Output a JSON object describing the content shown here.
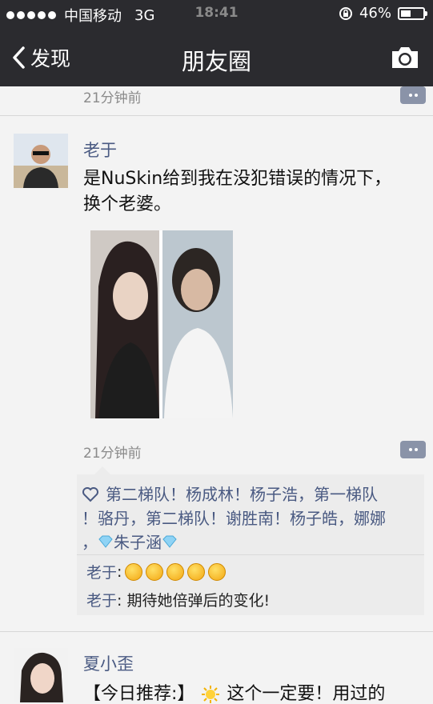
{
  "status_bar": {
    "carrier": "中国移动",
    "network": "3G",
    "time": "18:41",
    "battery": "46%",
    "battery_level": 0.46
  },
  "nav": {
    "back_label": "发现",
    "title": "朋友圈"
  },
  "feed": {
    "previous_post_time": "21分钟前",
    "posts": [
      {
        "author": "老于",
        "text_line1": "是NuSkin给到我在没犯错误的情况下，",
        "text_line2": "换个老婆。",
        "time": "21分钟前",
        "likes": {
          "line1": "第二梯队！杨成林！杨子浩，第一梯队",
          "line2": "！骆丹，第二梯队！谢胜南！杨子皓，娜娜",
          "line3_prefix": "，",
          "line3_name": "朱子涵"
        },
        "comments": [
          {
            "author": "老于",
            "text": ""
          },
          {
            "author": "老于",
            "text": "期待她倍弹后的变化!"
          }
        ]
      },
      {
        "author": "夏小歪",
        "text_prefix": "【今日推荐:】",
        "text_rest": "这个一定要！用过的"
      }
    ]
  },
  "colors": {
    "bar_bg": "#2b2b2f",
    "name_blue": "#4a5a82",
    "feed_bg": "#f3f3f3",
    "likes_bg": "#ececec"
  }
}
